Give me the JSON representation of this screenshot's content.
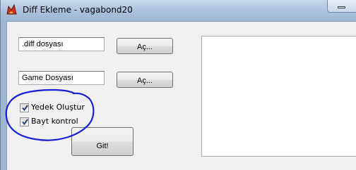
{
  "window": {
    "title": "Diff Ekleme - vagabond20",
    "icon": "app-icon",
    "minimize_icon": "minimize-icon"
  },
  "form": {
    "diff_field": {
      "value": ".diff dosyası"
    },
    "diff_open_button": {
      "label": "Aç..."
    },
    "game_field": {
      "value": "Game Dosyası"
    },
    "game_open_button": {
      "label": "Aç..."
    },
    "backup_checkbox": {
      "label": "Yedek Oluştur",
      "checked": true
    },
    "byte_check_checkbox": {
      "label": "Bayt kontrol",
      "checked": true
    },
    "go_button": {
      "label": "Git!"
    },
    "output_box": {
      "value": ""
    }
  },
  "colors": {
    "annotation_ink": "#1520d8",
    "titlebar": "#a9c1db"
  }
}
